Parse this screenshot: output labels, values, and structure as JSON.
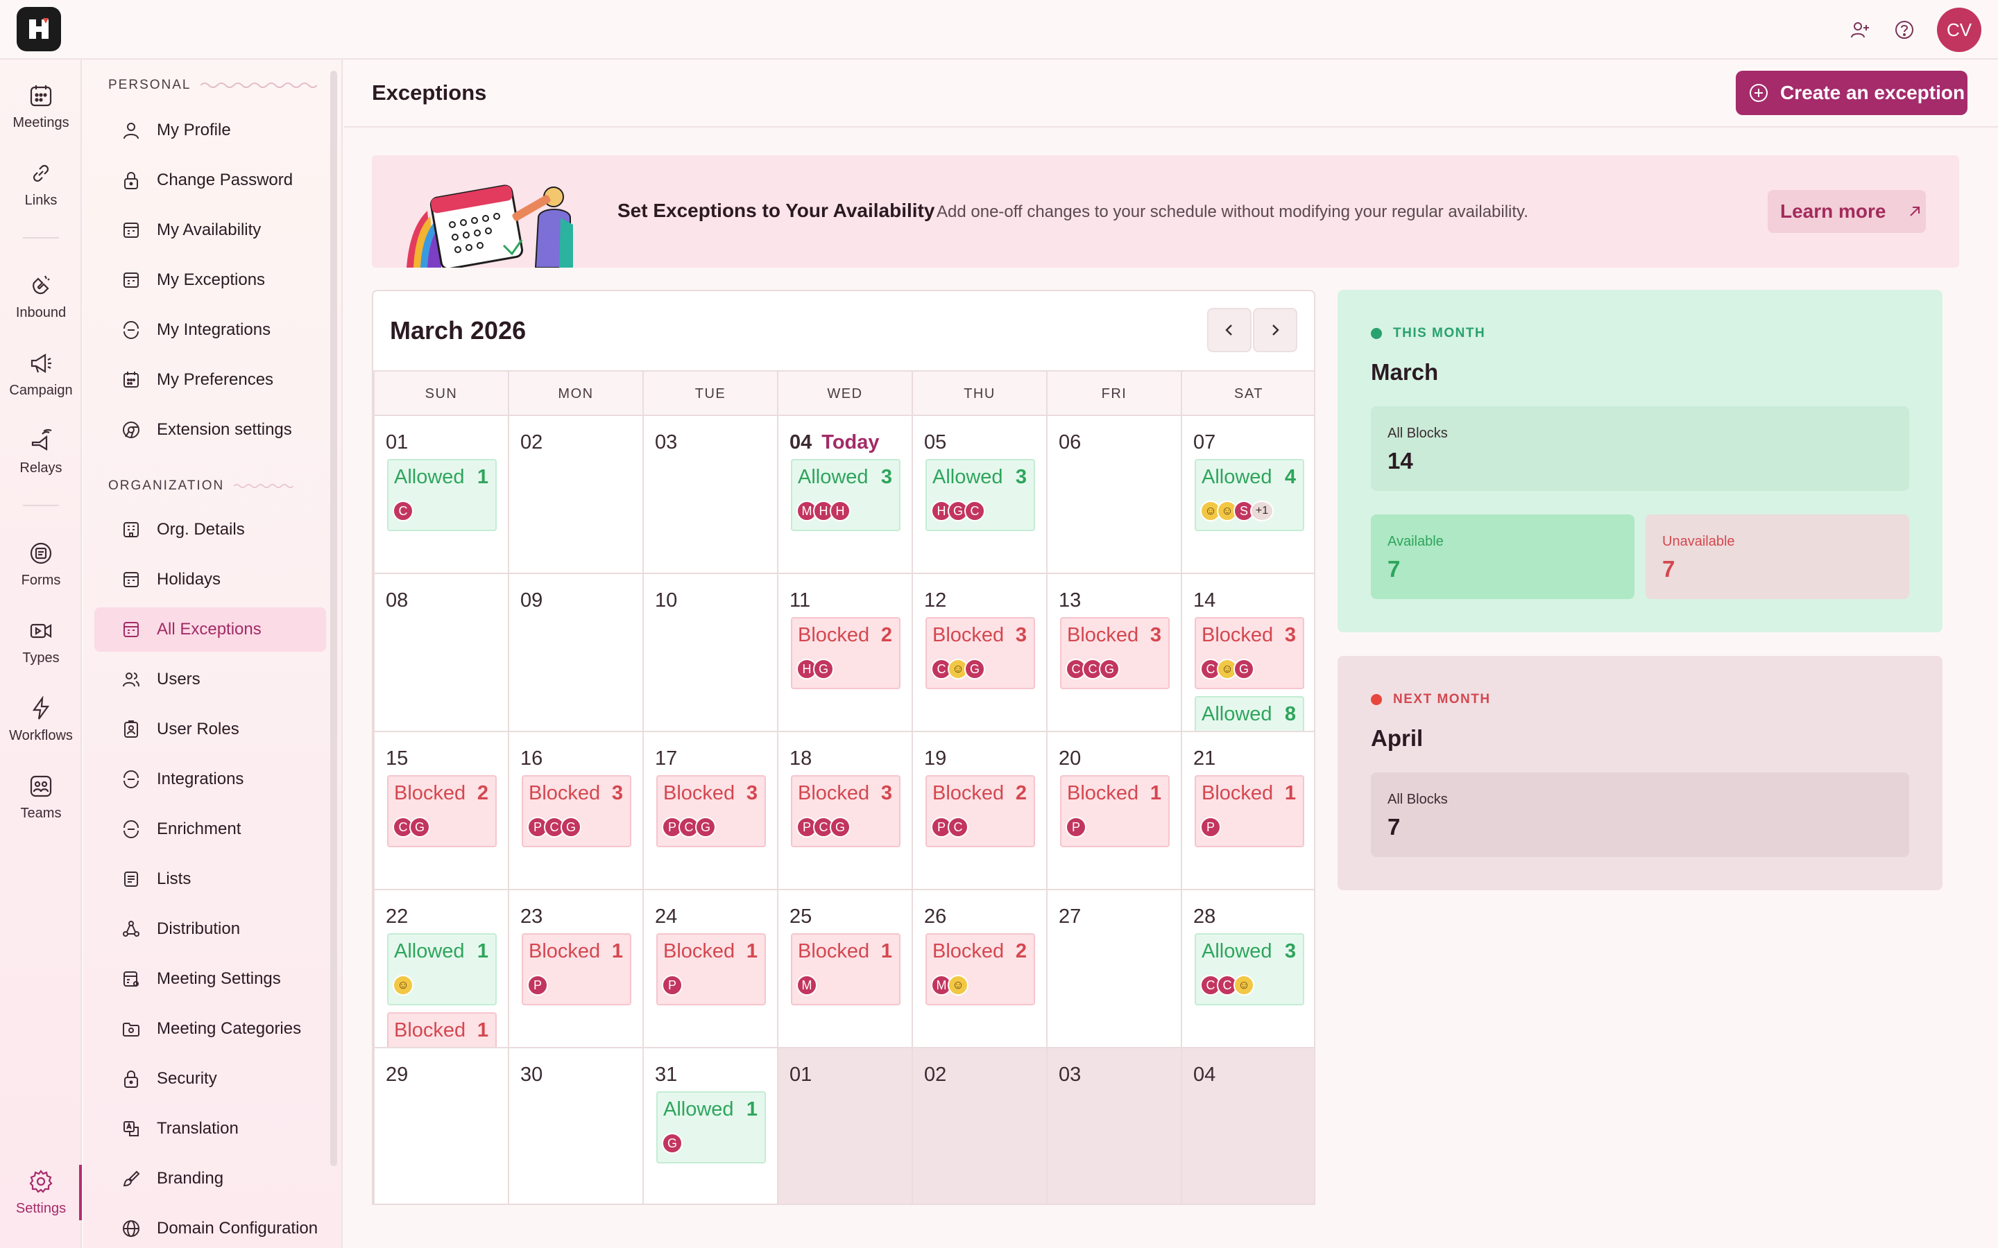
{
  "app": {
    "user_initials": "CV",
    "colors": {
      "brand": "#a52b6b",
      "allowed": "#2ea55c",
      "blocked": "#d4474f"
    }
  },
  "rail": {
    "items": [
      {
        "label": "Meetings",
        "icon": "calendar-grid-icon"
      },
      {
        "label": "Links",
        "icon": "link-icon"
      },
      {
        "label": "Inbound",
        "icon": "magnet-icon"
      },
      {
        "label": "Campaign",
        "icon": "megaphone-icon"
      },
      {
        "label": "Relays",
        "icon": "relay-icon"
      },
      {
        "label": "Forms",
        "icon": "form-icon"
      },
      {
        "label": "Types",
        "icon": "video-icon"
      },
      {
        "label": "Workflows",
        "icon": "lightning-icon"
      },
      {
        "label": "Teams",
        "icon": "team-icon"
      },
      {
        "label": "Settings",
        "icon": "gear-icon"
      }
    ]
  },
  "menu": {
    "personal_heading": "PERSONAL",
    "personal": [
      "My Profile",
      "Change Password",
      "My Availability",
      "My Exceptions",
      "My Integrations",
      "My Preferences",
      "Extension settings"
    ],
    "org_heading": "ORGANIZATION",
    "org": [
      "Org. Details",
      "Holidays",
      "All Exceptions",
      "Users",
      "User Roles",
      "Integrations",
      "Enrichment",
      "Lists",
      "Distribution",
      "Meeting Settings",
      "Meeting Categories",
      "Security",
      "Translation",
      "Branding",
      "Domain Configuration"
    ],
    "active": "All Exceptions"
  },
  "page": {
    "title": "Exceptions",
    "create_label": "Create an exception"
  },
  "banner": {
    "title": "Set Exceptions to Your Availability",
    "subtitle": "Add one-off changes to your schedule without modifying your regular availability.",
    "learn_more": "Learn more"
  },
  "calendar": {
    "title": "March 2026",
    "today_label": "Today",
    "weekdays": [
      "SUN",
      "MON",
      "TUE",
      "WED",
      "THU",
      "FRI",
      "SAT"
    ],
    "weeks": [
      [
        {
          "day": "01",
          "chips": [
            {
              "type": "Allowed",
              "count": "1",
              "avatars": [
                "C"
              ]
            }
          ]
        },
        {
          "day": "02",
          "chips": []
        },
        {
          "day": "03",
          "chips": []
        },
        {
          "day": "04",
          "today": true,
          "chips": [
            {
              "type": "Allowed",
              "count": "3",
              "avatars": [
                "M",
                "H",
                "H"
              ]
            }
          ]
        },
        {
          "day": "05",
          "chips": [
            {
              "type": "Allowed",
              "count": "3",
              "avatars": [
                "H",
                "G",
                "C"
              ]
            }
          ]
        },
        {
          "day": "06",
          "chips": []
        },
        {
          "day": "07",
          "chips": [
            {
              "type": "Allowed",
              "count": "4",
              "avatars": [
                "emoji",
                "emoji",
                "S",
                "+1"
              ]
            }
          ]
        }
      ],
      [
        {
          "day": "08",
          "chips": []
        },
        {
          "day": "09",
          "chips": []
        },
        {
          "day": "10",
          "chips": []
        },
        {
          "day": "11",
          "chips": [
            {
              "type": "Blocked",
              "count": "2",
              "avatars": [
                "H",
                "G"
              ]
            }
          ]
        },
        {
          "day": "12",
          "chips": [
            {
              "type": "Blocked",
              "count": "3",
              "avatars": [
                "C",
                "emoji",
                "G"
              ]
            }
          ]
        },
        {
          "day": "13",
          "chips": [
            {
              "type": "Blocked",
              "count": "3",
              "avatars": [
                "C",
                "C",
                "G"
              ]
            }
          ]
        },
        {
          "day": "14",
          "chips": [
            {
              "type": "Blocked",
              "count": "3",
              "avatars": [
                "C",
                "emoji",
                "G"
              ]
            },
            {
              "type": "Allowed",
              "count": "8",
              "avatars": []
            }
          ]
        }
      ],
      [
        {
          "day": "15",
          "chips": [
            {
              "type": "Blocked",
              "count": "2",
              "avatars": [
                "C",
                "G"
              ]
            }
          ]
        },
        {
          "day": "16",
          "chips": [
            {
              "type": "Blocked",
              "count": "3",
              "avatars": [
                "P",
                "C",
                "G"
              ]
            }
          ]
        },
        {
          "day": "17",
          "chips": [
            {
              "type": "Blocked",
              "count": "3",
              "avatars": [
                "P",
                "C",
                "G"
              ]
            }
          ]
        },
        {
          "day": "18",
          "chips": [
            {
              "type": "Blocked",
              "count": "3",
              "avatars": [
                "P",
                "C",
                "G"
              ]
            }
          ]
        },
        {
          "day": "19",
          "chips": [
            {
              "type": "Blocked",
              "count": "2",
              "avatars": [
                "P",
                "C"
              ]
            }
          ]
        },
        {
          "day": "20",
          "chips": [
            {
              "type": "Blocked",
              "count": "1",
              "avatars": [
                "P"
              ]
            }
          ]
        },
        {
          "day": "21",
          "chips": [
            {
              "type": "Blocked",
              "count": "1",
              "avatars": [
                "P"
              ]
            }
          ]
        }
      ],
      [
        {
          "day": "22",
          "chips": [
            {
              "type": "Allowed",
              "count": "1",
              "avatars": [
                "emoji"
              ]
            },
            {
              "type": "Blocked",
              "count": "1",
              "avatars": []
            }
          ]
        },
        {
          "day": "23",
          "chips": [
            {
              "type": "Blocked",
              "count": "1",
              "avatars": [
                "P"
              ]
            }
          ]
        },
        {
          "day": "24",
          "chips": [
            {
              "type": "Blocked",
              "count": "1",
              "avatars": [
                "P"
              ]
            }
          ]
        },
        {
          "day": "25",
          "chips": [
            {
              "type": "Blocked",
              "count": "1",
              "avatars": [
                "M"
              ]
            }
          ]
        },
        {
          "day": "26",
          "chips": [
            {
              "type": "Blocked",
              "count": "2",
              "avatars": [
                "M",
                "emoji"
              ]
            }
          ]
        },
        {
          "day": "27",
          "chips": []
        },
        {
          "day": "28",
          "chips": [
            {
              "type": "Allowed",
              "count": "3",
              "avatars": [
                "C",
                "C",
                "emoji"
              ]
            }
          ]
        }
      ],
      [
        {
          "day": "29",
          "chips": []
        },
        {
          "day": "30",
          "chips": []
        },
        {
          "day": "31",
          "chips": [
            {
              "type": "Allowed",
              "count": "1",
              "avatars": [
                "G"
              ]
            }
          ]
        },
        {
          "day": "01",
          "out": true,
          "chips": []
        },
        {
          "day": "02",
          "out": true,
          "chips": []
        },
        {
          "day": "03",
          "out": true,
          "chips": []
        },
        {
          "day": "04",
          "out": true,
          "chips": []
        }
      ]
    ]
  },
  "summary": {
    "this_month": {
      "tag": "THIS MONTH",
      "month": "March",
      "all_blocks_label": "All Blocks",
      "all_blocks": "14",
      "available_label": "Available",
      "available": "7",
      "unavailable_label": "Unavailable",
      "unavailable": "7"
    },
    "next_month": {
      "tag": "NEXT MONTH",
      "month": "April",
      "all_blocks_label": "All Blocks",
      "all_blocks": "7"
    }
  }
}
